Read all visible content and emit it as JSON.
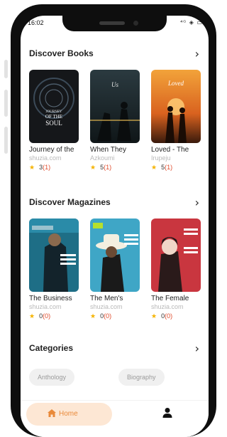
{
  "status_bar": {
    "time": "16:02",
    "icons_text": "⁴ᴳ ◈ ▭"
  },
  "sections": {
    "books": {
      "title": "Discover Books"
    },
    "magazines": {
      "title": "Discover Magazines"
    },
    "categories": {
      "title": "Categories"
    }
  },
  "books": [
    {
      "title": "Journey of the",
      "author": "shuzia.com",
      "rating": "3",
      "count": "(1)",
      "cover_text": "JOURNEY OF THE SOUL"
    },
    {
      "title": "When They",
      "author": "Azkoumi",
      "rating": "5",
      "count": "(1)",
      "cover_text": "Us"
    },
    {
      "title": "Loved - The",
      "author": "Irupeju",
      "rating": "5",
      "count": "(1)",
      "cover_text": "Loved"
    }
  ],
  "magazines": [
    {
      "title": "The Business",
      "author": "shuzia.com",
      "rating": "0",
      "count": "(0)"
    },
    {
      "title": "The Men's",
      "author": "shuzia.com",
      "rating": "0",
      "count": "(0)"
    },
    {
      "title": "The Female",
      "author": "shuzia.com",
      "rating": "0",
      "count": "(0)"
    }
  ],
  "categories": [
    "Anthology",
    "Biography"
  ],
  "nav": {
    "home_label": "Home"
  },
  "colors": {
    "accent": "#e98a3a",
    "home_bg": "#fde7d4",
    "star": "#f5b301",
    "count": "#e04b2b"
  }
}
